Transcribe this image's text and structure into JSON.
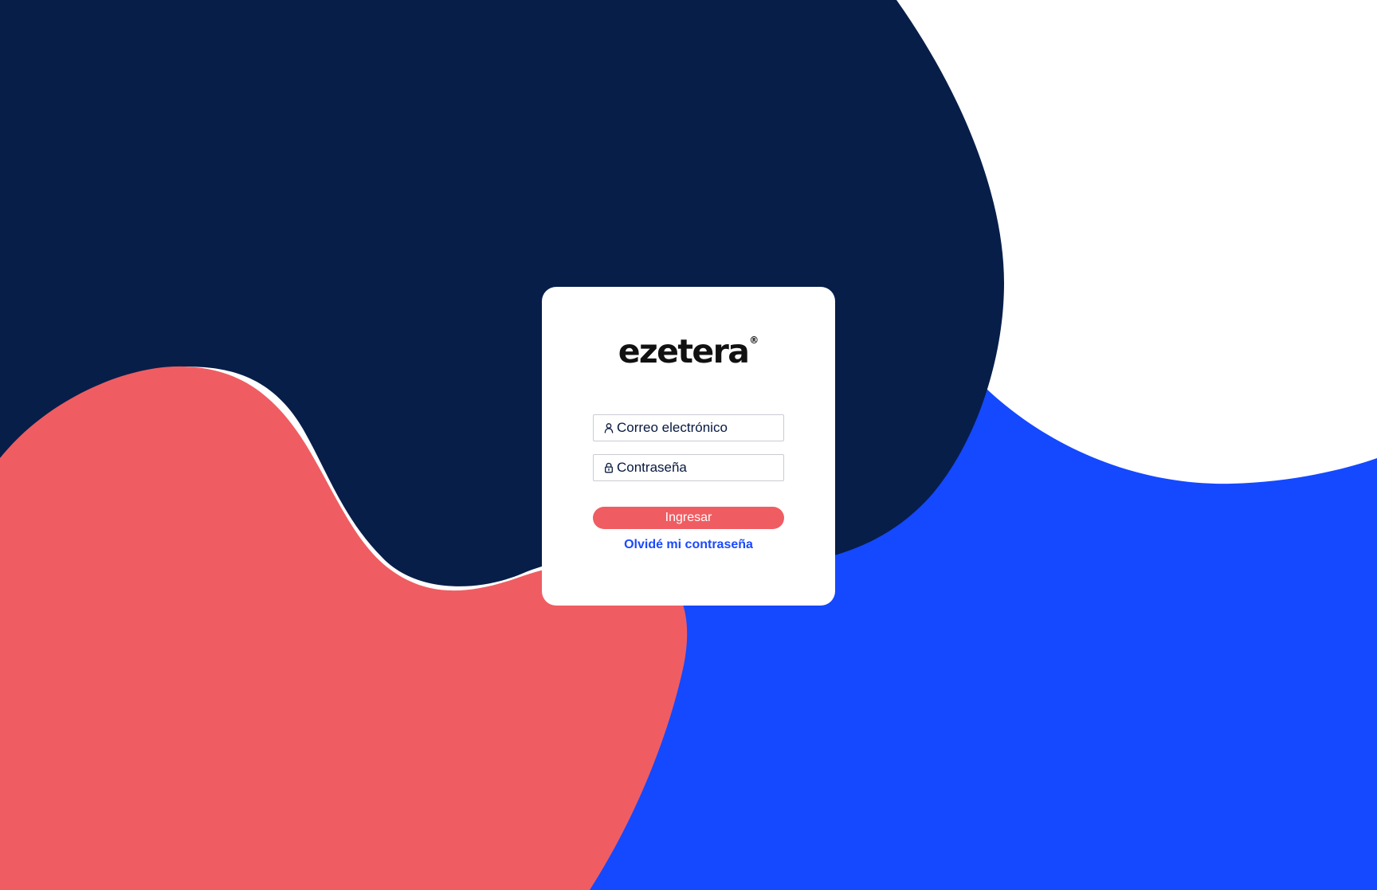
{
  "app": {
    "brand": "ezetera",
    "brand_mark": "®"
  },
  "login": {
    "email_placeholder": "Correo electrónico",
    "password_placeholder": "Contraseña",
    "submit_label": "Ingresar",
    "forgot_password_label": "Olvidé mi contraseña"
  },
  "icons": {
    "email": "user-icon",
    "password": "lock-icon"
  },
  "colors": {
    "navy": "#071e49",
    "coral": "#ef5d62",
    "blue": "#1449ff",
    "white": "#ffffff",
    "input_text": "#07183f",
    "link": "#1b49ff"
  }
}
